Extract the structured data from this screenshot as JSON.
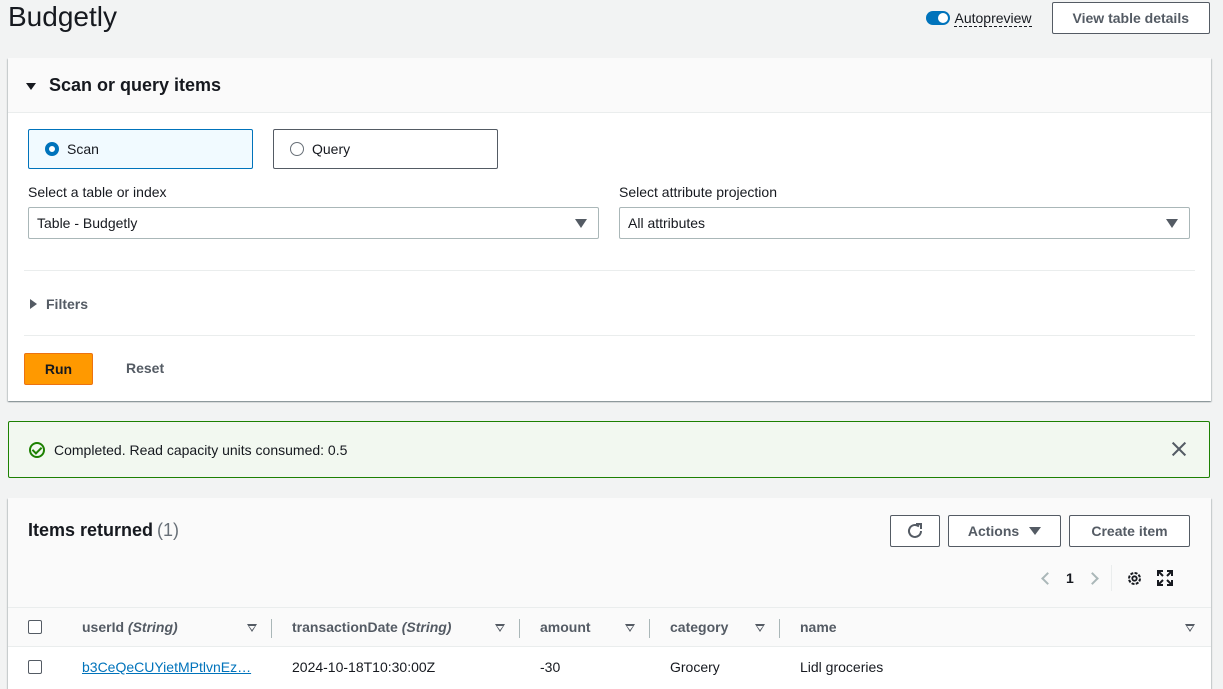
{
  "page": {
    "title": "Budgetly",
    "autopreview_label": "Autopreview",
    "view_details_label": "View table details"
  },
  "scan_panel": {
    "title": "Scan or query items",
    "mode_scan": "Scan",
    "mode_query": "Query",
    "selected_mode": "Scan",
    "table_label": "Select a table or index",
    "table_value": "Table - Budgetly",
    "projection_label": "Select attribute projection",
    "projection_value": "All attributes",
    "filters_label": "Filters",
    "run_label": "Run",
    "reset_label": "Reset"
  },
  "flash": {
    "message": "Completed. Read capacity units consumed: 0.5",
    "status_color": "#1d8102"
  },
  "items": {
    "title": "Items returned",
    "count": "(1)",
    "actions_label": "Actions",
    "create_label": "Create item",
    "page_number": "1",
    "columns": [
      {
        "name": "userId",
        "type": "(String)"
      },
      {
        "name": "transactionDate",
        "type": "(String)"
      },
      {
        "name": "amount",
        "type": ""
      },
      {
        "name": "category",
        "type": ""
      },
      {
        "name": "name",
        "type": ""
      }
    ],
    "rows": [
      {
        "userId": "b3CeQeCUYietMPtlvnEz…",
        "transactionDate": "2024-10-18T10:30:00Z",
        "amount": "-30",
        "category": "Grocery",
        "name": "Lidl groceries"
      }
    ]
  },
  "icons": {
    "refresh": "refresh-icon",
    "settings": "gear-icon",
    "fullscreen": "expand-icon",
    "success": "check-circle-icon",
    "close": "close-icon"
  },
  "colors": {
    "accent": "#0073bb",
    "primary_button": "#ff9900"
  }
}
